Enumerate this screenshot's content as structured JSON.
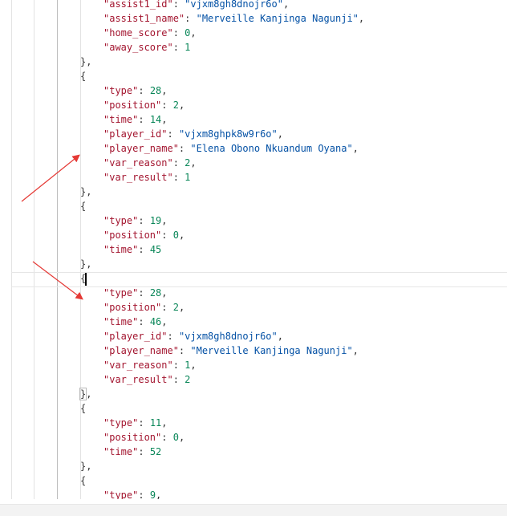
{
  "editor": {
    "lines": [
      {
        "indent": 2,
        "key": "assist1_id",
        "value": "vjxm8gh8dnojr6o",
        "vtype": "str",
        "comma": true
      },
      {
        "indent": 2,
        "key": "assist1_name",
        "value": "Merveille Kanjinga Nagunji",
        "vtype": "str",
        "comma": true
      },
      {
        "indent": 2,
        "key": "home_score",
        "value": "0",
        "vtype": "num",
        "comma": true
      },
      {
        "indent": 2,
        "key": "away_score",
        "value": "1",
        "vtype": "num",
        "comma": false
      },
      {
        "indent": 1,
        "punct": "},"
      },
      {
        "indent": 1,
        "punct": "{"
      },
      {
        "indent": 2,
        "key": "type",
        "value": "28",
        "vtype": "num",
        "comma": true
      },
      {
        "indent": 2,
        "key": "position",
        "value": "2",
        "vtype": "num",
        "comma": true
      },
      {
        "indent": 2,
        "key": "time",
        "value": "14",
        "vtype": "num",
        "comma": true
      },
      {
        "indent": 2,
        "key": "player_id",
        "value": "vjxm8ghpk8w9r6o",
        "vtype": "str",
        "comma": true
      },
      {
        "indent": 2,
        "key": "player_name",
        "value": "Elena Obono Nkuandum Oyana",
        "vtype": "str",
        "comma": true
      },
      {
        "indent": 2,
        "key": "var_reason",
        "value": "2",
        "vtype": "num",
        "comma": true
      },
      {
        "indent": 2,
        "key": "var_result",
        "value": "1",
        "vtype": "num",
        "comma": false
      },
      {
        "indent": 1,
        "punct": "},"
      },
      {
        "indent": 1,
        "punct": "{"
      },
      {
        "indent": 2,
        "key": "type",
        "value": "19",
        "vtype": "num",
        "comma": true
      },
      {
        "indent": 2,
        "key": "position",
        "value": "0",
        "vtype": "num",
        "comma": true
      },
      {
        "indent": 2,
        "key": "time",
        "value": "45",
        "vtype": "num",
        "comma": false
      },
      {
        "indent": 1,
        "punct": "},"
      },
      {
        "indent": 1,
        "punct": "{",
        "current": true
      },
      {
        "indent": 2,
        "key": "type",
        "value": "28",
        "vtype": "num",
        "comma": true
      },
      {
        "indent": 2,
        "key": "position",
        "value": "2",
        "vtype": "num",
        "comma": true
      },
      {
        "indent": 2,
        "key": "time",
        "value": "46",
        "vtype": "num",
        "comma": true
      },
      {
        "indent": 2,
        "key": "player_id",
        "value": "vjxm8gh8dnojr6o",
        "vtype": "str",
        "comma": true
      },
      {
        "indent": 2,
        "key": "player_name",
        "value": "Merveille Kanjinga Nagunji",
        "vtype": "str",
        "comma": true
      },
      {
        "indent": 2,
        "key": "var_reason",
        "value": "1",
        "vtype": "num",
        "comma": true
      },
      {
        "indent": 2,
        "key": "var_result",
        "value": "2",
        "vtype": "num",
        "comma": false
      },
      {
        "indent": 1,
        "punct": "},",
        "bracket_box": true
      },
      {
        "indent": 1,
        "punct": "{"
      },
      {
        "indent": 2,
        "key": "type",
        "value": "11",
        "vtype": "num",
        "comma": true
      },
      {
        "indent": 2,
        "key": "position",
        "value": "0",
        "vtype": "num",
        "comma": true
      },
      {
        "indent": 2,
        "key": "time",
        "value": "52",
        "vtype": "num",
        "comma": false
      },
      {
        "indent": 1,
        "punct": "},"
      },
      {
        "indent": 1,
        "punct": "{"
      },
      {
        "indent": 2,
        "key": "type",
        "value": "9",
        "vtype": "num",
        "comma": true
      }
    ]
  },
  "colors": {
    "key": "#a3152f",
    "string": "#0451a5",
    "number": "#098658",
    "annotation_arrow": "#e53935"
  }
}
